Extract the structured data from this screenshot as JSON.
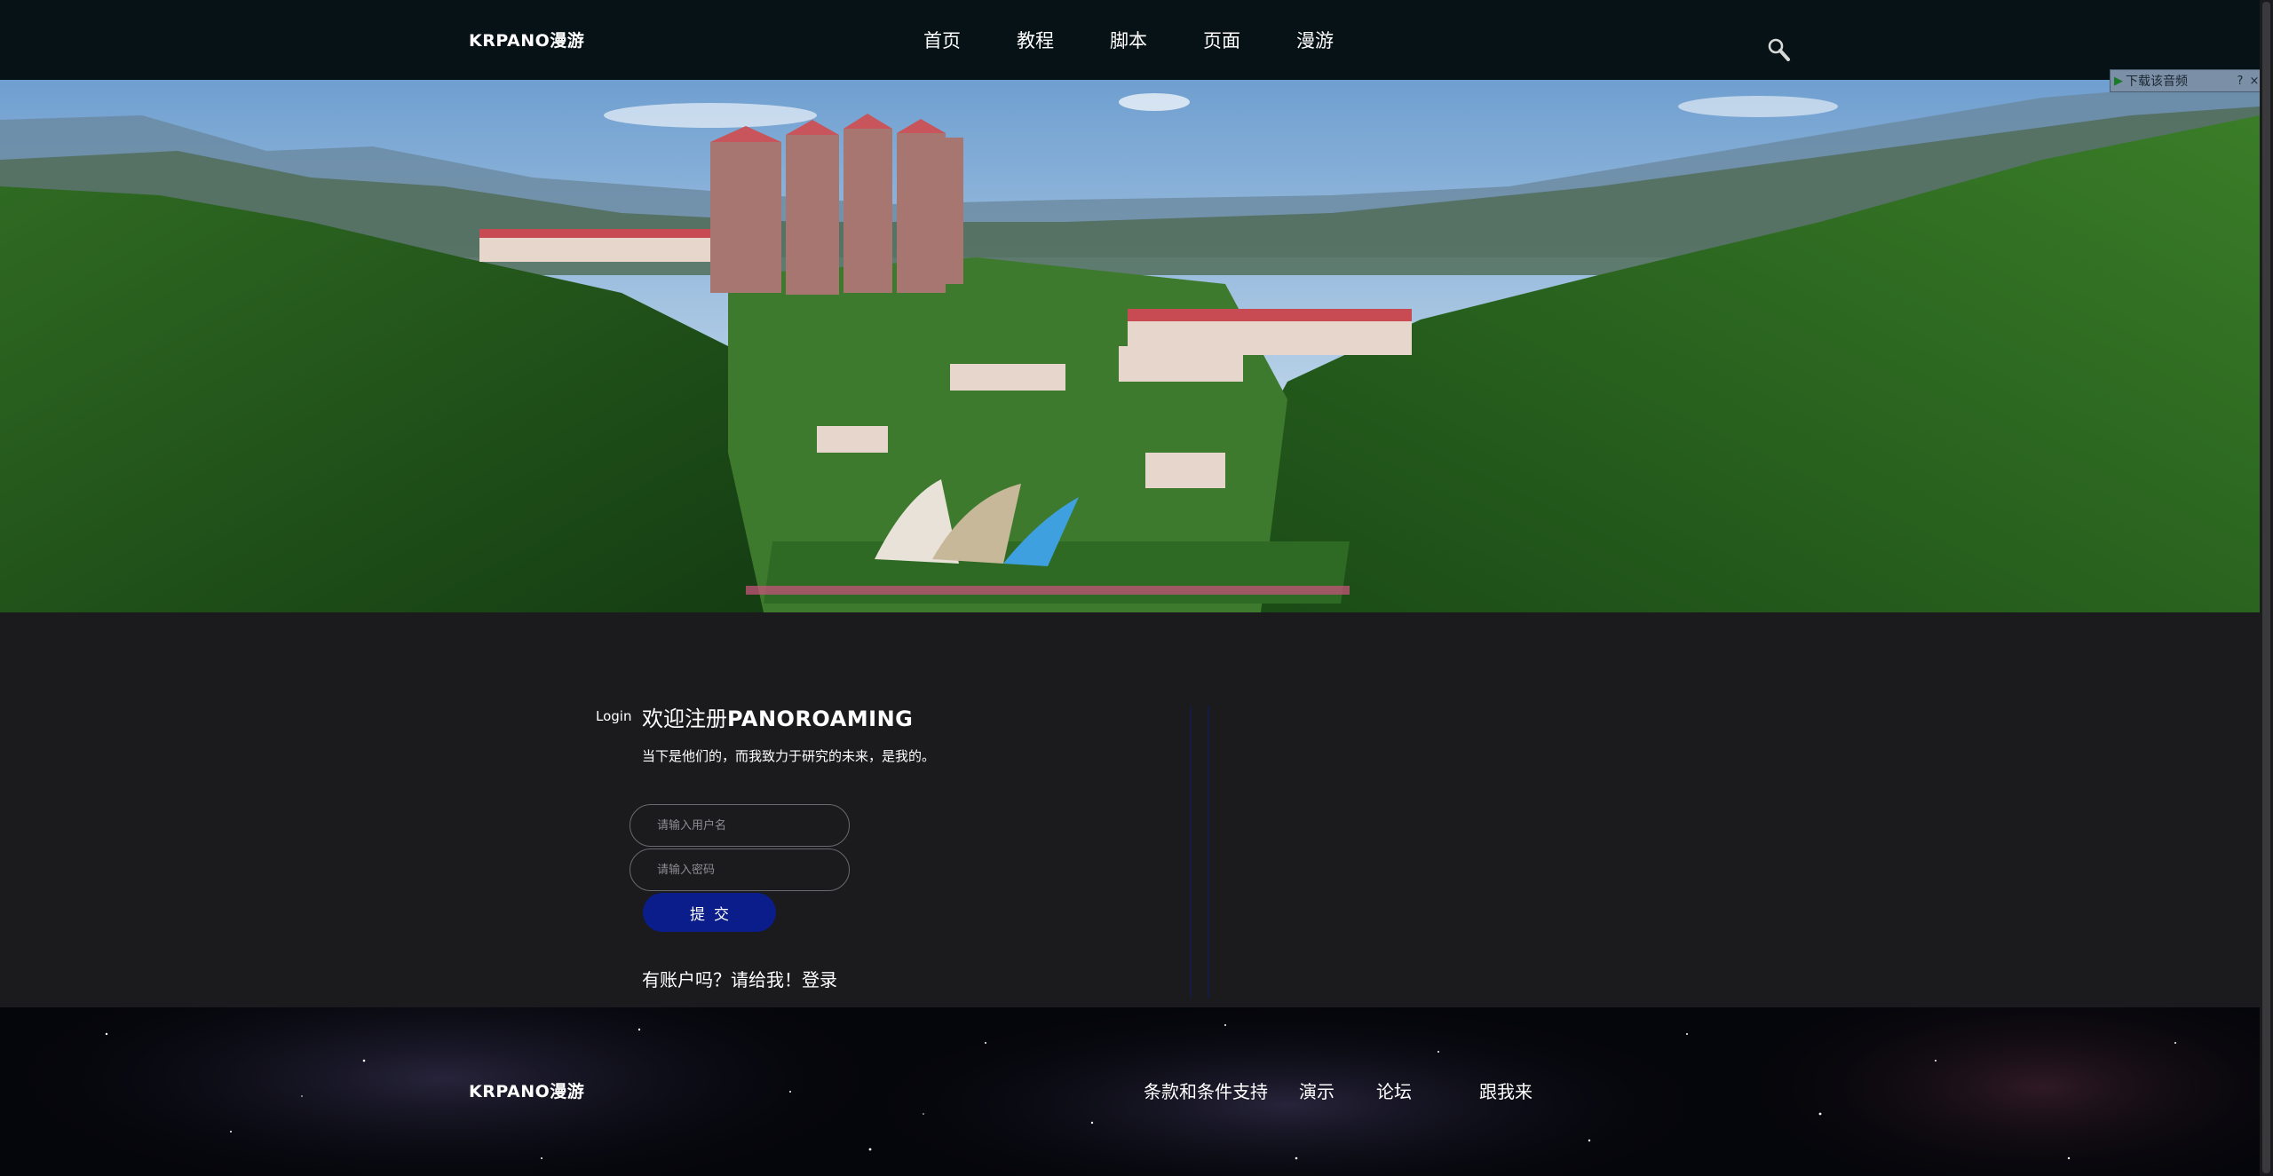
{
  "header": {
    "logo": "KRPANO漫游",
    "nav": [
      {
        "label": "首页"
      },
      {
        "label": "教程"
      },
      {
        "label": "脚本"
      },
      {
        "label": "页面"
      },
      {
        "label": "漫游"
      }
    ],
    "search_icon": "search-icon"
  },
  "audio_widget": {
    "label": "下载该音频",
    "help": "?",
    "close": "×"
  },
  "login": {
    "side_label": "Login",
    "title_prefix": "欢迎注册",
    "title_brand": "PANOROAMING",
    "subtitle": "当下是他们的，而我致力于研究的未来，是我的。",
    "username_placeholder": "请输入用户名",
    "password_placeholder": "请输入密码",
    "submit_label": "提交",
    "account_prompt": "有账户吗？请给我！",
    "login_link": "登录"
  },
  "footer": {
    "logo": "KRPANO漫游",
    "links": [
      {
        "label": "条款和条件支持"
      },
      {
        "label": "演示"
      },
      {
        "label": "论坛"
      },
      {
        "label": "跟我来"
      }
    ]
  },
  "colors": {
    "header_bg": "#071216",
    "page_bg": "#1b1b1d",
    "submit_bg": "#0a1d8a"
  }
}
